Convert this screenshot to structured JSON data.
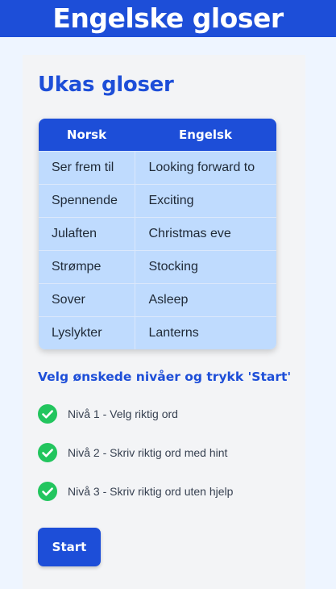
{
  "header": {
    "title": "Engelske gloser"
  },
  "card": {
    "title": "Ukas gloser",
    "table": {
      "headers": [
        "Norsk",
        "Engelsk"
      ],
      "rows": [
        [
          "Ser frem til",
          "Looking forward to"
        ],
        [
          "Spennende",
          "Exciting"
        ],
        [
          "Julaften",
          "Christmas eve"
        ],
        [
          "Strømpe",
          "Stocking"
        ],
        [
          "Sover",
          "Asleep"
        ],
        [
          "Lyslykter",
          "Lanterns"
        ]
      ]
    },
    "levels_title": "Velg ønskede nivåer og trykk 'Start'",
    "levels": [
      {
        "label": "Nivå 1 - Velg riktig ord",
        "checked": true,
        "icon": "check-circle-icon"
      },
      {
        "label": "Nivå 2 - Skriv riktig ord med hint",
        "checked": true,
        "icon": "check-circle-icon"
      },
      {
        "label": "Nivå 3 - Skriv riktig ord uten hjelp",
        "checked": true,
        "icon": "check-circle-icon"
      }
    ],
    "start_label": "Start"
  },
  "colors": {
    "primary": "#1d4ed8",
    "table_cell": "#bfdbfe",
    "check": "#22c55e",
    "page_bg": "#eef5ff",
    "card_bg": "#f3f4f6"
  }
}
